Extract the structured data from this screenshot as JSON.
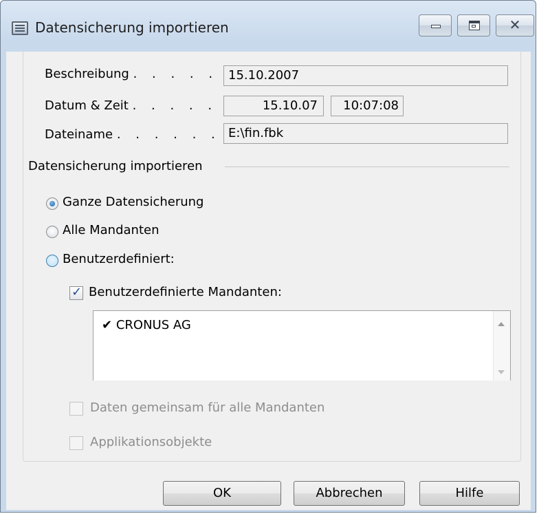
{
  "window": {
    "title": "Datensicherung importieren"
  },
  "fields": {
    "beschreibung": {
      "label": "Beschreibung",
      "dots": ". . . . . .",
      "value": "15.10.2007"
    },
    "datum_zeit": {
      "label": "Datum & Zeit",
      "dots": ". . . . . .",
      "date": "15.10.07",
      "time": "10:07:08"
    },
    "dateiname": {
      "label": "Dateiname",
      "dots": ". . . . . . .",
      "value": "E:\\fin.fbk"
    }
  },
  "section": {
    "title": "Datensicherung importieren"
  },
  "options": {
    "ganze": {
      "label": "Ganze Datensicherung",
      "selected": true
    },
    "alle": {
      "label": "Alle Mandanten",
      "selected": false
    },
    "benutzer": {
      "label": "Benutzerdefiniert:",
      "selected": false
    }
  },
  "custom_companies": {
    "label": "Benutzerdefinierte Mandanten:",
    "checked": true,
    "items": [
      {
        "mark": "✔",
        "name": "CRONUS AG"
      }
    ]
  },
  "disabled_options": {
    "daten": {
      "label": "Daten gemeinsam für alle Mandanten"
    },
    "app": {
      "label": "Applikationsobjekte"
    }
  },
  "buttons": {
    "ok": "OK",
    "cancel": "Abbrechen",
    "help": "Hilfe"
  },
  "icons": {
    "window": "table-window-icon",
    "minimize": "minimize-icon",
    "maximize": "maximize-icon",
    "close": "close-icon",
    "scroll_up": "scroll-up-arrow-icon",
    "scroll_down": "scroll-down-arrow-icon",
    "check": "checkmark-icon"
  },
  "close_glyph": "✕"
}
